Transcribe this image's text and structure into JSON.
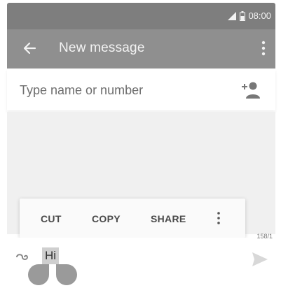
{
  "status_bar": {
    "time": "08:00",
    "icons": [
      "signal-icon",
      "battery-icon"
    ]
  },
  "app_bar": {
    "title": "New message",
    "icons": [
      "back-arrow-icon",
      "overflow-menu-icon"
    ]
  },
  "recipient": {
    "placeholder": "Type name or number",
    "value": "",
    "icon": "add-contact-icon"
  },
  "selection_toolbar": {
    "cut_label": "CUT",
    "copy_label": "COPY",
    "share_label": "SHARE",
    "more_icon": "vertical-dots-icon"
  },
  "compose": {
    "text": "Hi",
    "char_counter": "158/1",
    "icons": [
      "attach-icon",
      "send-icon"
    ]
  },
  "colors": {
    "status_bar": "#7e7e7e",
    "app_bar": "#8f8f8f",
    "conversation_bg": "#f0f0f0",
    "selection_highlight": "#cfcfcf",
    "selection_handle": "#9a9a9a"
  }
}
